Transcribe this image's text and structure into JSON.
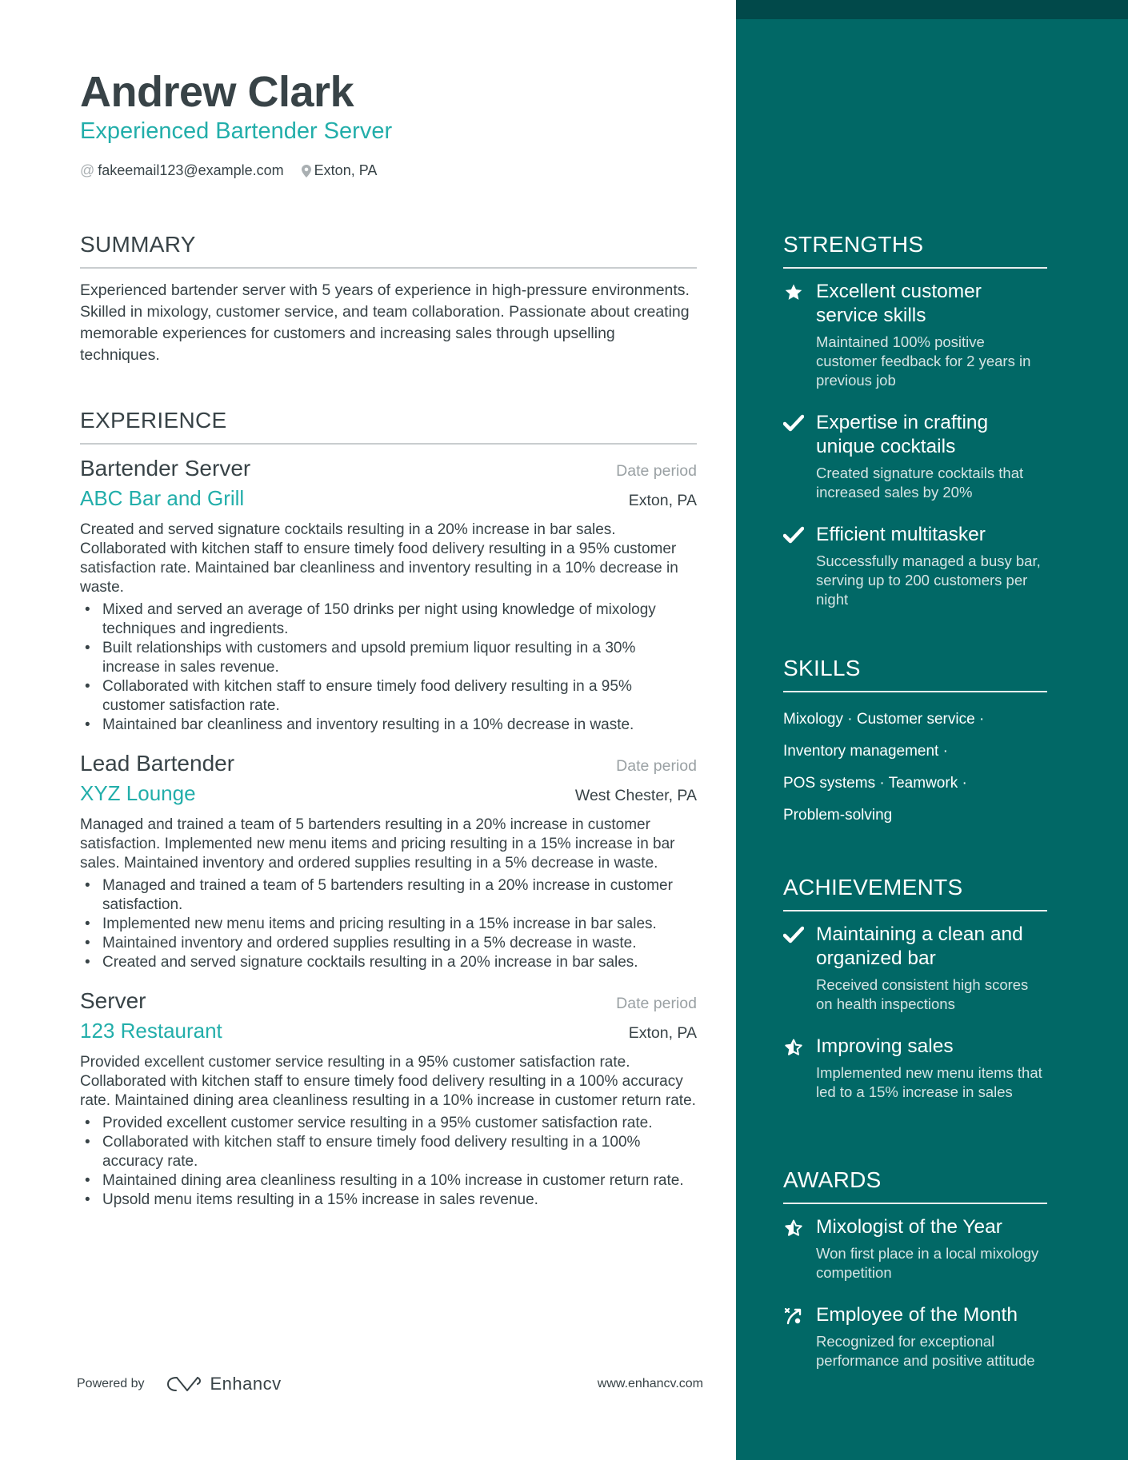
{
  "header": {
    "name": "Andrew Clark",
    "headline": "Experienced Bartender Server",
    "email": "fakeemail123@example.com",
    "location": "Exton, PA",
    "email_icon": "at-icon",
    "location_icon": "map-pin-icon"
  },
  "summary": {
    "title": "SUMMARY",
    "text": "Experienced bartender server with 5 years of experience in high-pressure environments. Skilled in mixology, customer service, and team collaboration. Passionate about creating memorable experiences for customers and increasing sales through upselling techniques."
  },
  "experience": {
    "title": "EXPERIENCE",
    "jobs": [
      {
        "title": "Bartender Server",
        "date": "Date period",
        "company": "ABC Bar and Grill",
        "location": "Exton, PA",
        "description": "Created and served signature cocktails resulting in a 20% increase in bar sales. Collaborated with kitchen staff to ensure timely food delivery resulting in a 95% customer satisfaction rate. Maintained bar cleanliness and inventory resulting in a 10% decrease in waste.",
        "bullets": [
          "Mixed and served an average of 150 drinks per night using knowledge of mixology techniques and ingredients.",
          "Built relationships with customers and upsold premium liquor resulting in a 30% increase in sales revenue.",
          "Collaborated with kitchen staff to ensure timely food delivery resulting in a 95% customer satisfaction rate.",
          "Maintained bar cleanliness and inventory resulting in a 10% decrease in waste."
        ]
      },
      {
        "title": "Lead Bartender",
        "date": "Date period",
        "company": "XYZ Lounge",
        "location": "West Chester, PA",
        "description": "Managed and trained a team of 5 bartenders resulting in a 20% increase in customer satisfaction. Implemented new menu items and pricing resulting in a 15% increase in bar sales. Maintained inventory and ordered supplies resulting in a 5% decrease in waste.",
        "bullets": [
          "Managed and trained a team of 5 bartenders resulting in a 20% increase in customer satisfaction.",
          "Implemented new menu items and pricing resulting in a 15% increase in bar sales.",
          "Maintained inventory and ordered supplies resulting in a 5% decrease in waste.",
          "Created and served signature cocktails resulting in a 20% increase in bar sales."
        ]
      },
      {
        "title": "Server",
        "date": "Date period",
        "company": "123 Restaurant",
        "location": "Exton, PA",
        "description": "Provided excellent customer service resulting in a 95% customer satisfaction rate. Collaborated with kitchen staff to ensure timely food delivery resulting in a 100% accuracy rate. Maintained dining area cleanliness resulting in a 10% increase in customer return rate.",
        "bullets": [
          "Provided excellent customer service resulting in a 95% customer satisfaction rate.",
          "Collaborated with kitchen staff to ensure timely food delivery resulting in a 100% accuracy rate.",
          "Maintained dining area cleanliness resulting in a 10% increase in customer return rate.",
          "Upsold menu items resulting in a 15% increase in sales revenue."
        ]
      }
    ]
  },
  "strengths": {
    "title": "STRENGTHS",
    "items": [
      {
        "icon": "star-icon",
        "title": "Excellent customer service skills",
        "description": "Maintained 100% positive customer feedback for 2 years in previous job"
      },
      {
        "icon": "check-icon",
        "title": "Expertise in crafting unique cocktails",
        "description": "Created signature cocktails that increased sales by 20%"
      },
      {
        "icon": "check-icon",
        "title": "Efficient multitasker",
        "description": "Successfully managed a busy bar, serving up to 200 customers per night"
      }
    ]
  },
  "skills": {
    "title": "SKILLS",
    "lines": [
      "Mixology · Customer service ·",
      "Inventory management ·",
      "POS systems · Teamwork ·",
      "Problem-solving"
    ]
  },
  "achievements": {
    "title": "ACHIEVEMENTS",
    "items": [
      {
        "icon": "check-icon",
        "title": "Maintaining a clean and organized bar",
        "description": "Received consistent high scores on health inspections"
      },
      {
        "icon": "half-star-icon",
        "title": "Improving sales",
        "description": "Implemented new menu items that led to a 15% increase in sales"
      }
    ]
  },
  "awards": {
    "title": "AWARDS",
    "items": [
      {
        "icon": "half-star-icon",
        "title": "Mixologist of the Year",
        "description": "Won first place in a local mixology competition"
      },
      {
        "icon": "strategy-icon",
        "title": "Employee of the Month",
        "description": "Recognized for exceptional performance and positive attitude"
      }
    ]
  },
  "footer": {
    "powered_by": "Powered by",
    "brand": "Enhancv",
    "website": "www.enhancv.com"
  },
  "colors": {
    "accent": "#22aeaa",
    "sidebar": "#016866",
    "sidebar_top": "#01494a",
    "text": "#384347",
    "muted": "#9aa1a4"
  }
}
